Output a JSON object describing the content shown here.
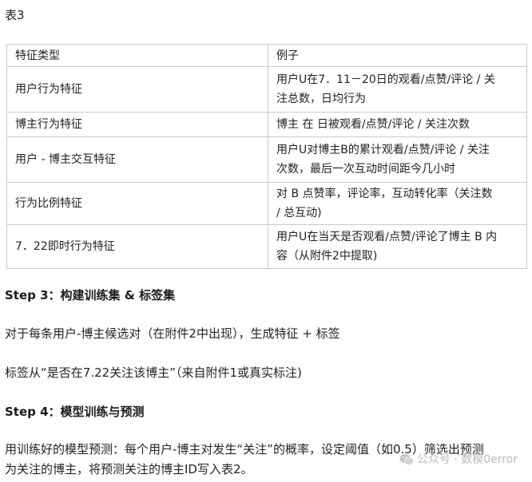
{
  "caption": "表3",
  "table": {
    "rows": [
      {
        "c1": "特征类型",
        "c2": "例子",
        "h": 28
      },
      {
        "c1": "用户行为特征",
        "c2": [
          "用户U在7．11－20日的观看/点赞/评论 / 关",
          "注总数，日均行为"
        ],
        "h": 57
      },
      {
        "c1": "博主行为特征",
        "c2": [
          "博主 在 日被观看/点赞/评论 / 关注次数"
        ],
        "h": 31
      },
      {
        "c1": "用户 - 博主交互特征",
        "c2": [
          "用户U对博主B的累计观看/点赞/评论 / 关注",
          "次数，最后一次互动时间距今几小时"
        ],
        "h": 57
      },
      {
        "c1": "行为比例特征",
        "c2": [
          "对 B 点赞率，评论率，互动转化率（关注数",
          " / 总互动)"
        ],
        "h": 53
      },
      {
        "c1": "7．22即时行为特征",
        "c2": [
          "用户U在当天是否观看/点赞/评论了博主 B 内",
          "容（从附件2中提取)"
        ],
        "h": 55
      }
    ]
  },
  "step3": {
    "heading": "Step 3：构建训练集 & 标签集",
    "para1": "对于每条用户-博主候选对（在附件2中出现），生成特征 + 标签",
    "para2": "标签从“是否在7.22关注该博主”（来自附件1或真实标注)"
  },
  "step4": {
    "heading": "Step 4：模型训练与预测",
    "para_line1": "用训练好的模型预测：每个用户-博主对发生“关注”的概率，设定阈值（如0.5）筛选出预测",
    "para_line2": "为关注的博主，将预测关注的博主ID写入表2。"
  },
  "watermark": {
    "icon": "wechat-icon",
    "text": "公众号 · 数模0error"
  }
}
